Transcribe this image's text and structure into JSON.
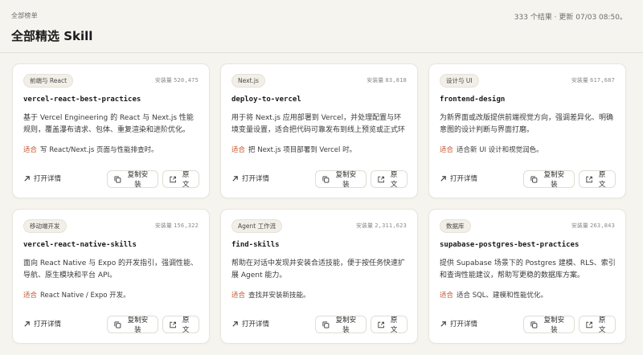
{
  "header": {
    "eyebrow": "全部榜单",
    "title": "全部精选 Skill",
    "meta": "333 个结果 · 更新 07/03 08:50。"
  },
  "labels": {
    "installs": "安装量",
    "fit": "适合",
    "open": "打开详情",
    "copy": "复制安装",
    "source": "原文"
  },
  "cards": [
    {
      "tag": "前端与 React",
      "installs": "520,475",
      "name": "vercel-react-best-practices",
      "desc": "基于 Vercel Engineering 的 React 与 Next.js 性能规则，覆盖瀑布请求、包体、重复渲染和进阶优化。",
      "fit": "写 React/Next.js 页面与性能排查时。"
    },
    {
      "tag": "Next.js",
      "installs": "83,818",
      "name": "deploy-to-vercel",
      "desc": "用于将 Next.js 应用部署到 Vercel，并处理配置与环境变量设置，适合把代码可靠发布到线上预览或正式环境。",
      "fit": "把 Next.js 项目部署到 Vercel 时。"
    },
    {
      "tag": "设计与 UI",
      "installs": "617,687",
      "name": "frontend-design",
      "desc": "为新界面或改版提供前端视觉方向，强调差异化、明确意图的设计判断与界面打磨。",
      "fit": "适合新 UI 设计和视觉润色。"
    },
    {
      "tag": "移动端开发",
      "installs": "156,322",
      "name": "vercel-react-native-skills",
      "desc": "面向 React Native 与 Expo 的开发指引，强调性能、导航、原生模块和平台 API。",
      "fit": "React Native / Expo 开发。"
    },
    {
      "tag": "Agent 工作流",
      "installs": "2,311,623",
      "name": "find-skills",
      "desc": "帮助在对话中发现并安装合适技能，便于按任务快速扩展 Agent 能力。",
      "fit": "查找并安装新技能。"
    },
    {
      "tag": "数据库",
      "installs": "263,843",
      "name": "supabase-postgres-best-practices",
      "desc": "提供 Supabase 场景下的 Postgres 建模、RLS、索引和查询性能建议，帮助写更稳的数据库方案。",
      "fit": "适合 SQL、建模和性能优化。"
    }
  ],
  "colors": {
    "background": "#f6f4ef",
    "card": "#ffffff",
    "fit_accent": "#c0532a"
  }
}
